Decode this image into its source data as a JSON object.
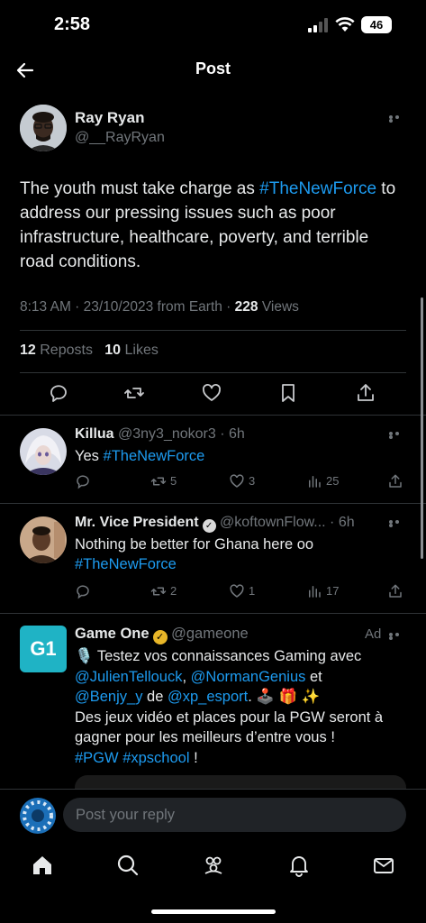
{
  "status_bar": {
    "time": "2:58",
    "battery": "46",
    "icons": [
      "signal-icon",
      "wifi-icon",
      "battery-icon"
    ]
  },
  "header": {
    "title": "Post",
    "back_icon": "back-arrow-icon"
  },
  "main_post": {
    "author_name": "Ray Ryan",
    "author_handle": "@__RayRyan",
    "text_before": "The youth must take charge as ",
    "hashtag": "#TheNewForce",
    "text_after": " to address our pressing issues such as poor infrastructure, healthcare, poverty, and terrible road conditions.",
    "meta": "8:13 AM · 23/10/2023 from Earth · ",
    "views_count": "228",
    "views_label": " Views",
    "reposts_count": "12",
    "reposts_label": " Reposts",
    "likes_count": "10",
    "likes_label": " Likes",
    "actions": [
      "reply-icon",
      "repost-icon",
      "like-icon",
      "bookmark-icon",
      "share-icon"
    ]
  },
  "replies": [
    {
      "name": "Killua",
      "handle": " @3ny3_nokor3 · 6h",
      "text_before": "Yes ",
      "hashtag": "#TheNewForce",
      "reposts": "5",
      "likes": "3",
      "views": "25"
    },
    {
      "name": "Mr. Vice President",
      "handle": " @koftownFlow... · 6h",
      "text_before": "Nothing be better for Ghana here oo",
      "hashtag": "#TheNewForce",
      "reposts": "2",
      "likes": "1",
      "views": "17"
    }
  ],
  "ad": {
    "name": "Game One",
    "handle": " @gameone",
    "badge": "Ad",
    "logo_text": "G1",
    "line1": "🎙️ Testez vos connaissances Gaming avec",
    "mention1": "@JulienTellouck",
    "sep1": ", ",
    "mention2": "@NormanGenius",
    "sep2": " et",
    "mention3": "@Benjy_y",
    "sep3": " de ",
    "mention4": "@xp_esport",
    "emoji": ". 🕹️ 🎁 ✨",
    "line4": "Des jeux vidéo et places pour la PGW seront à gagner pour les meilleurs d’entre vous !",
    "tag1": "#PGW",
    "tag2": "#xpschool",
    "end": " !"
  },
  "reply_bar": {
    "placeholder": "Post your reply"
  },
  "tab_bar": {
    "icons": [
      "home-icon",
      "search-icon",
      "communities-icon",
      "notifications-icon",
      "messages-icon"
    ]
  },
  "colors": {
    "background": "#000000",
    "accent": "#1d9bf0",
    "muted": "#71767b",
    "text": "#e7e9ea"
  }
}
